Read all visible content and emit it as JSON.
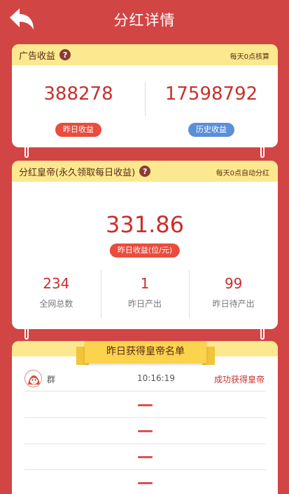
{
  "header": {
    "title": "分红详情",
    "back_icon": "back-arrow-icon"
  },
  "ad_income": {
    "title": "广告收益",
    "note": "每天0点核算",
    "yesterday": {
      "value": "388278",
      "label": "昨日收益",
      "color": "#e84d3d"
    },
    "history": {
      "value": "17598792",
      "label": "历史收益",
      "color": "#5b8fd8"
    }
  },
  "emperor": {
    "title": "分红皇帝(永久领取每日收益)",
    "note": "每天0点自动分红",
    "amount": "331.86",
    "amount_label": "昨日收益(位/元)",
    "stats": [
      {
        "value": "234",
        "label": "全网总数"
      },
      {
        "value": "1",
        "label": "昨日产出"
      },
      {
        "value": "99",
        "label": "昨日待产出"
      }
    ]
  },
  "list": {
    "title": "昨日获得皇帝名单",
    "winner": {
      "name": "群",
      "time": "10:16:19",
      "status": "成功获得皇帝"
    },
    "empty_rows": 4
  },
  "colors": {
    "background": "#d24545",
    "accent": "#c9302c",
    "header_band": "#fce98f"
  }
}
